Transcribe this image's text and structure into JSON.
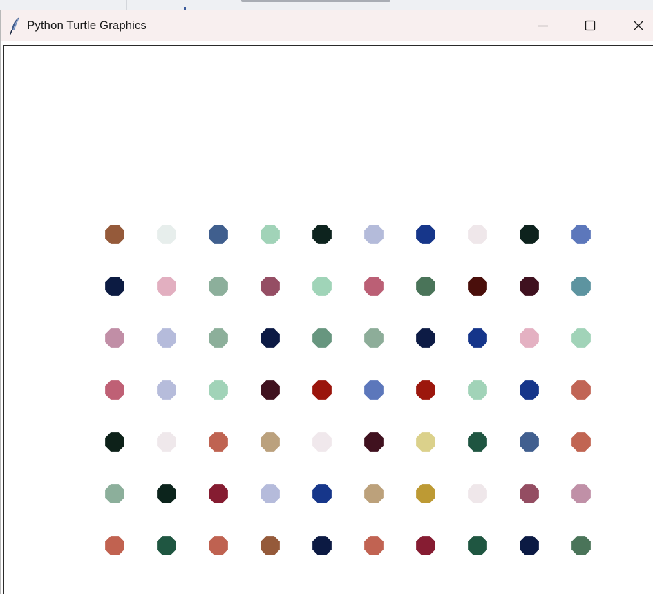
{
  "window": {
    "title": "Python Turtle Graphics",
    "icon": "feather-icon",
    "controls": [
      "minimize-icon",
      "maximize-icon",
      "close-icon"
    ]
  },
  "canvas": {
    "background": "#ffffff",
    "dot_grid": {
      "rows": 7,
      "cols": 10,
      "colors": [
        [
          "#955a3a",
          "#e7eeec",
          "#405f8e",
          "#a1d3b8",
          "#0d231e",
          "#b4bbda",
          "#16368a",
          "#efe7ea",
          "#0d221d",
          "#5c77bb"
        ],
        [
          "#0c1b42",
          "#e2afc0",
          "#8caf9b",
          "#954e64",
          "#a0d4b8",
          "#bb5f75",
          "#4a7459",
          "#4a0f0b",
          "#3f111f",
          "#5d94a0"
        ],
        [
          "#c18ea6",
          "#b5bbdb",
          "#8caf9a",
          "#0c1a44",
          "#67967f",
          "#8dad99",
          "#0d1b45",
          "#15358a",
          "#e4b1c2",
          "#a1d3b8"
        ],
        [
          "#bf6075",
          "#b6bcdb",
          "#a1d3b8",
          "#40121f",
          "#9a150c",
          "#5c77bb",
          "#9c170d",
          "#a1d3b8",
          "#16368a",
          "#c16555"
        ],
        [
          "#0d2119",
          "#efe8eb",
          "#bf6351",
          "#bba17d",
          "#f0e8ec",
          "#40111f",
          "#dbd18b",
          "#1f5541",
          "#415f8f",
          "#c16552"
        ],
        [
          "#8caf9b",
          "#0c241c",
          "#851c31",
          "#b5bbdb",
          "#16368a",
          "#bca17b",
          "#bd9a34",
          "#efe7ea",
          "#944d62",
          "#c090a7"
        ],
        [
          "#c16250",
          "#1f5641",
          "#bf6251",
          "#955a3a",
          "#0c1a43",
          "#c16352",
          "#861c32",
          "#1f5641",
          "#0b1a43",
          "#4a7459"
        ]
      ]
    }
  }
}
